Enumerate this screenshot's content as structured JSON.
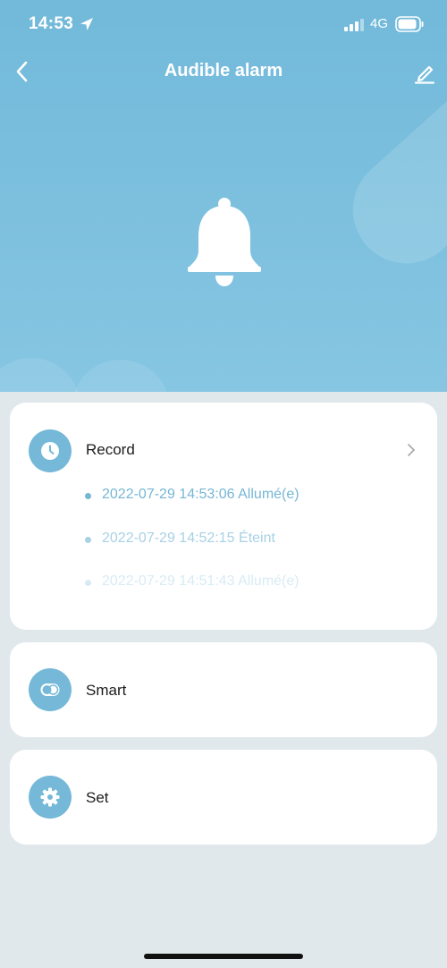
{
  "status_bar": {
    "time": "14:53",
    "network": "4G"
  },
  "header": {
    "title": "Audible alarm"
  },
  "record": {
    "label": "Record",
    "entries": [
      {
        "text": "2022-07-29 14:53:06 Allumé(e)"
      },
      {
        "text": "2022-07-29 14:52:15 Éteint"
      },
      {
        "text": "2022-07-29 14:51:43 Allumé(e)"
      }
    ]
  },
  "smart": {
    "label": "Smart"
  },
  "settings": {
    "label": "Set"
  },
  "colors": {
    "hero_top": "#72b9da",
    "hero_bottom": "#86c6e2",
    "accent": "#75b8d8",
    "background": "#e1e8ec",
    "card": "#ffffff"
  },
  "icons": {
    "back": "chevron-left-icon",
    "edit": "pencil-icon",
    "hero": "bell-icon",
    "record": "clock-icon",
    "smart": "toggle-icon",
    "settings": "gear-icon",
    "record_more": "chevron-right-icon"
  }
}
